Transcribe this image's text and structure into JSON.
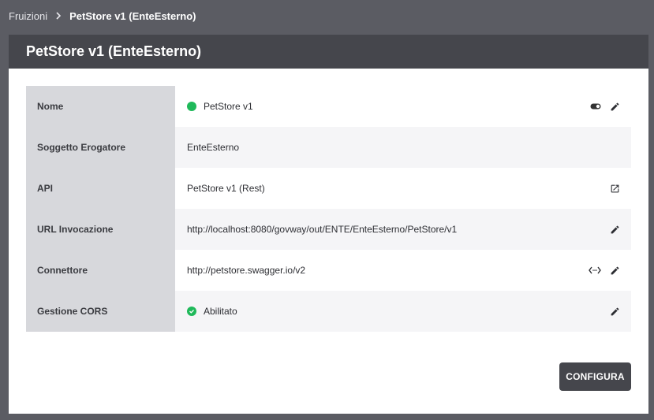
{
  "breadcrumb": {
    "parent": "Fruizioni",
    "current": "PetStore v1 (EnteEsterno)"
  },
  "panel": {
    "title": "PetStore v1 (EnteEsterno)"
  },
  "details": {
    "nome": {
      "label": "Nome",
      "value": "PetStore v1",
      "status_color": "#1fb95a"
    },
    "soggetto": {
      "label": "Soggetto Erogatore",
      "value": "EnteEsterno"
    },
    "api": {
      "label": "API",
      "value": "PetStore v1 (Rest)"
    },
    "url": {
      "label": "URL Invocazione",
      "value": "http://localhost:8080/govway/out/ENTE/EnteEsterno/PetStore/v1"
    },
    "connettore": {
      "label": "Connettore",
      "value": "http://petstore.swagger.io/v2"
    },
    "cors": {
      "label": "Gestione CORS",
      "value": "Abilitato",
      "status_color": "#1fb95a"
    }
  },
  "actions": {
    "configure_label": "CONFIGURA"
  }
}
